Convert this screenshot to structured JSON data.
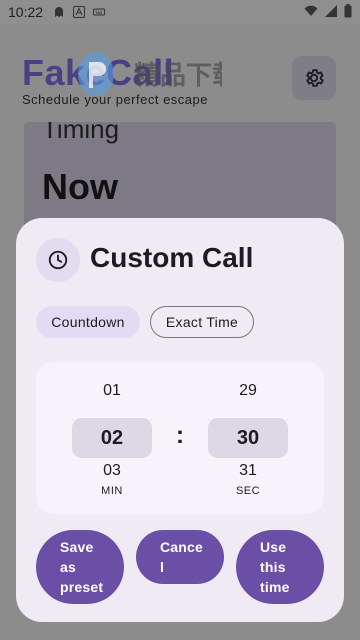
{
  "status_bar": {
    "time": "10:22",
    "left_icons": [
      "ghost-icon",
      "font-a-icon",
      "keyboard-icon"
    ],
    "right_icons": [
      "wifi-icon",
      "signal-icon",
      "battery-icon"
    ]
  },
  "app": {
    "logo": "FakeCall",
    "tagline": "Schedule your perfect escape",
    "watermark_text": "精品下载",
    "settings_icon": "gear-icon"
  },
  "timing": {
    "label": "Timing",
    "value": "Now"
  },
  "dialog": {
    "icon": "clock-icon",
    "title": "Custom Call",
    "tabs": [
      {
        "label": "Countdown",
        "selected": true
      },
      {
        "label": "Exact Time",
        "selected": false
      }
    ],
    "picker": {
      "minutes": {
        "prev": "01",
        "current": "02",
        "next": "03",
        "unit": "MIN"
      },
      "separator": ":",
      "seconds": {
        "prev": "29",
        "current": "30",
        "next": "31",
        "unit": "SEC"
      }
    },
    "buttons": {
      "save": [
        "Save",
        "as",
        "preset"
      ],
      "cancel": [
        "Cance",
        "l"
      ],
      "use": [
        "Use",
        "this",
        "time"
      ]
    }
  },
  "colors": {
    "accent": "#6b4fa6",
    "dialog_bg": "#efeaf4",
    "scrim": "#8c8c8c"
  }
}
